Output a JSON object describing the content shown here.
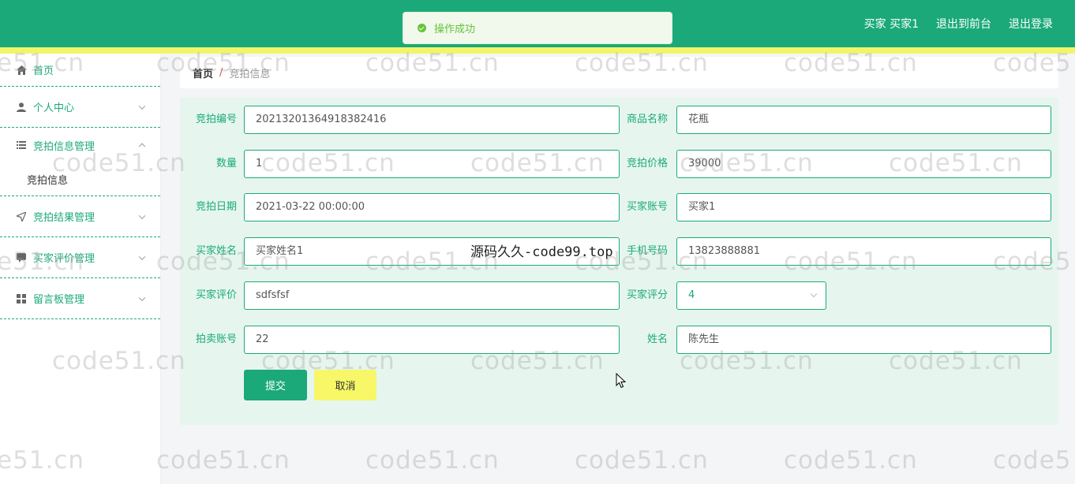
{
  "header": {
    "user_label": "买家 买家1",
    "to_front_label": "退出到前台",
    "logout_label": "退出登录"
  },
  "toast": {
    "message": "操作成功"
  },
  "sidebar": {
    "items": [
      {
        "label": "首页",
        "icon": "home-icon"
      },
      {
        "label": "个人中心",
        "icon": "user-icon"
      },
      {
        "label": "竞拍信息管理",
        "icon": "list-icon",
        "children": [
          "竞拍信息"
        ]
      },
      {
        "label": "竞拍结果管理",
        "icon": "send-icon"
      },
      {
        "label": "买家评价管理",
        "icon": "chat-icon"
      },
      {
        "label": "留言板管理",
        "icon": "grid-icon"
      }
    ]
  },
  "breadcrumb": {
    "home": "首页",
    "separator": "/",
    "current": "竞拍信息"
  },
  "form": {
    "auction_no": {
      "label": "竞拍编号",
      "value": "20213201364918382416"
    },
    "product_name": {
      "label": "商品名称",
      "value": "花瓶"
    },
    "quantity": {
      "label": "数量",
      "value": "1"
    },
    "auction_price": {
      "label": "竞拍价格",
      "value": "39000"
    },
    "auction_date": {
      "label": "竞拍日期",
      "value": "2021-03-22 00:00:00"
    },
    "buyer_account": {
      "label": "买家账号",
      "value": "买家1"
    },
    "buyer_name": {
      "label": "买家姓名",
      "value": "买家姓名1"
    },
    "phone": {
      "label": "手机号码",
      "value": "13823888881"
    },
    "buyer_review": {
      "label": "买家评价",
      "value": "sdfsfsf"
    },
    "buyer_score": {
      "label": "买家评分",
      "value": "4"
    },
    "seller_account": {
      "label": "拍卖账号",
      "value": "22"
    },
    "seller_name": {
      "label": "姓名",
      "value": "陈先生"
    },
    "submit_label": "提交",
    "cancel_label": "取消"
  },
  "watermarks": {
    "site": "code51.cn",
    "site_partial_left": "e51.cn",
    "site_partial_right": "code5",
    "overlay": "源码久久-code99.top"
  },
  "colors": {
    "primary": "#1ba97a",
    "accent": "#f2f56a",
    "panel": "#e6f6ef",
    "cancel": "#f7f768"
  }
}
